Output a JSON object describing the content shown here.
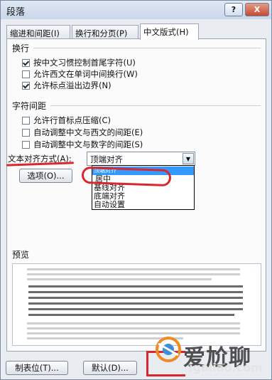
{
  "window": {
    "title": "段落",
    "help_label": "?",
    "close_label": "X"
  },
  "tabs": [
    {
      "label": "缩进和间距(I)"
    },
    {
      "label": "换行和分页(P)"
    },
    {
      "label": "中文版式(H)"
    }
  ],
  "line_break": {
    "section_label": "换行",
    "options": [
      {
        "label": "按中文习惯控制首尾字符(U)",
        "checked": true
      },
      {
        "label": "允许西文在单词中间换行(W)",
        "checked": false
      },
      {
        "label": "允许标点溢出边界(N)",
        "checked": true
      }
    ]
  },
  "char_spacing": {
    "section_label": "字符间距",
    "options": [
      {
        "label": "允许行首标点压缩(C)",
        "checked": false
      },
      {
        "label": "自动调整中文与西文的间距(E)",
        "checked": false
      },
      {
        "label": "自动调整中文与数字的间距(S)",
        "checked": false
      }
    ]
  },
  "text_align": {
    "label": "文本对齐方式(A):",
    "value": "顶端对齐",
    "options": [
      "顶端对齐",
      "居中",
      "基线对齐",
      "底端对齐",
      "自动设置"
    ],
    "highlighted_option_text": "顶端对齐"
  },
  "options_button": "选项(O)...",
  "preview": {
    "section_label": "预览"
  },
  "buttons": {
    "tabs_label": "制表位(T)...",
    "default_label": "默认(D)..."
  },
  "watermark": {
    "brand": "爱尬聊",
    "url": "igaliao.com",
    "partial_text": "qk5ufu.com"
  },
  "colors": {
    "annotation_red": "#d8282d",
    "selection_blue": "#3399ff"
  }
}
